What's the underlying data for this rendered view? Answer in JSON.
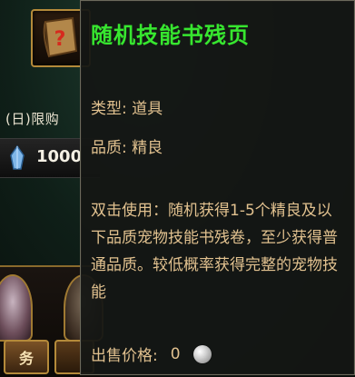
{
  "background": {
    "limit_label": "(日)限购",
    "price_value": "1000",
    "task_button_label": "务"
  },
  "tooltip": {
    "title": "随机技能书残页",
    "type_line": "类型: 道具",
    "quality_line": "品质: 精良",
    "description": "双击使用：随机获得1-5个精良及以下品质宠物技能书残卷，至少获得普通品质。较低概率获得完整的宠物技能",
    "sell_label": "出售价格:",
    "sell_value": "0"
  },
  "icons": {
    "item": "scroll-item-icon",
    "currency": "crystal-icon",
    "coin": "silver-coin-icon"
  },
  "colors": {
    "title": "#37e62f",
    "body_text": "#e1c18f",
    "frame_gold": "#b48a3a"
  }
}
